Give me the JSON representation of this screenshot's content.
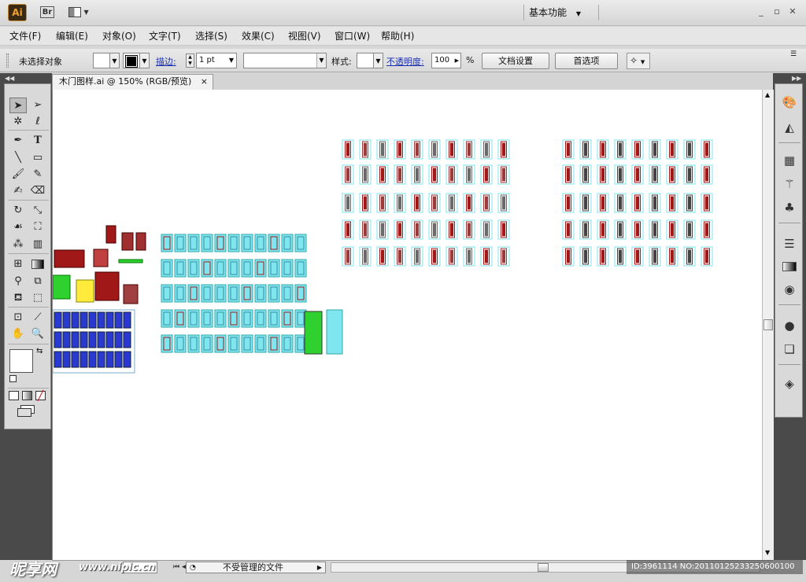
{
  "app": {
    "logo": "Ai",
    "bridge_label": "Br",
    "workspace": "基本功能",
    "window_controls": [
      "_",
      "▫",
      "✕"
    ]
  },
  "menu": [
    "文件(F)",
    "编辑(E)",
    "对象(O)",
    "文字(T)",
    "选择(S)",
    "效果(C)",
    "视图(V)",
    "窗口(W)",
    "帮助(H)"
  ],
  "control_bar": {
    "selection": "未选择对象",
    "stroke_label": "描边:",
    "stroke_value": "1 pt",
    "style_label": "样式:",
    "opacity_label": "不透明度:",
    "opacity_value": "100",
    "percent": "%",
    "doc_setup": "文档设置",
    "prefs": "首选项"
  },
  "document": {
    "tab_title": "木门图样.ai @ 150% (RGB/预览)",
    "tab_close": "×"
  },
  "status": {
    "file_status": "不受管理的文件"
  },
  "watermark": {
    "brand": "昵享网",
    "site": "www.nipic.cn",
    "id_text": "ID:3961114 NO:20110125233250600100"
  },
  "colors": {
    "cyan": "#7fe6ef",
    "blue": "#2a3ad0",
    "red": "#a01818",
    "green": "#2fd12f",
    "olive": "#8a7a20"
  }
}
